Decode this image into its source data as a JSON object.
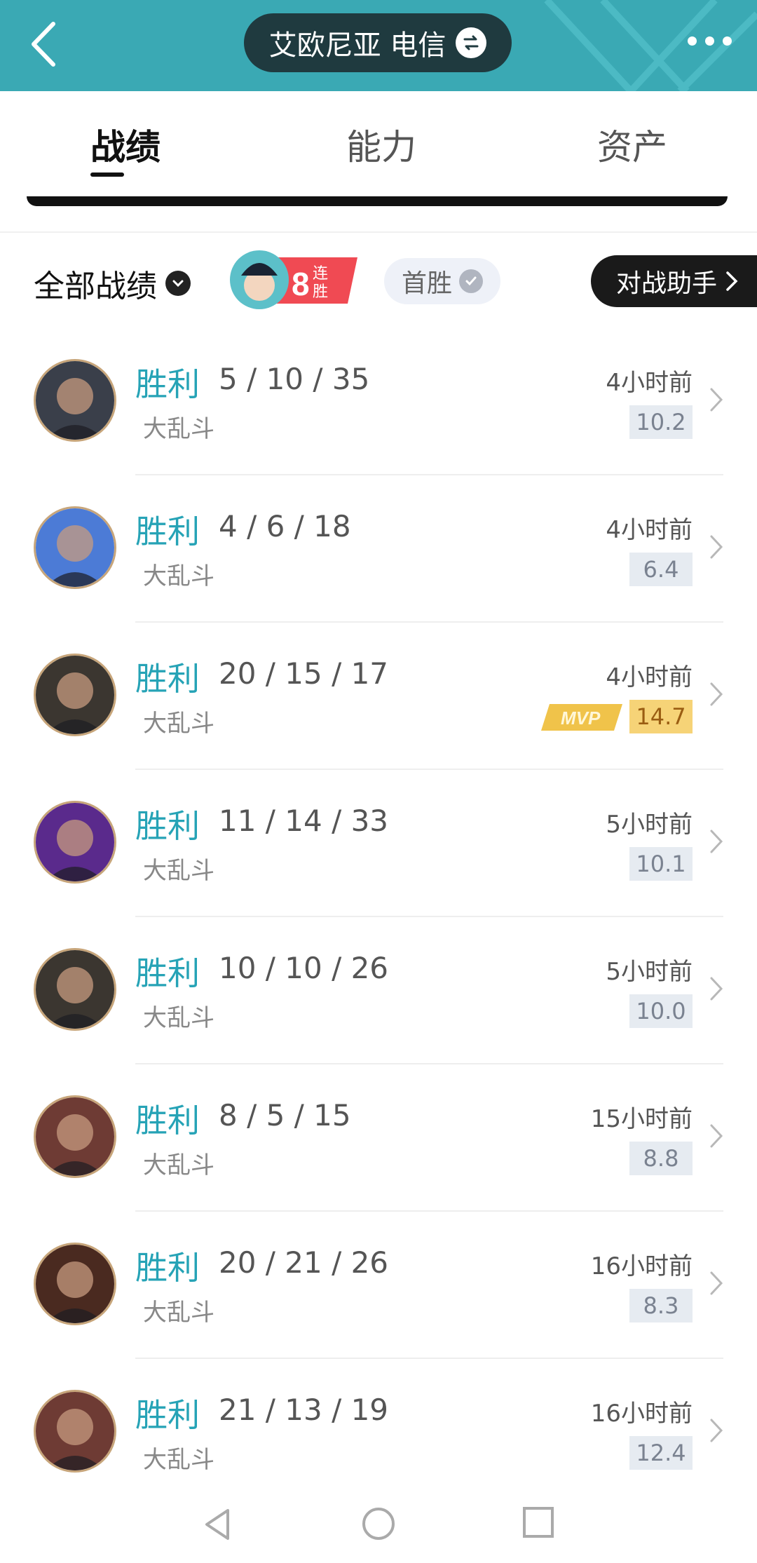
{
  "header": {
    "server_name": "艾欧尼亚 电信",
    "back_icon": "chevron-left-icon",
    "swap_icon": "swap-icon",
    "more_icon": "more-dots-icon"
  },
  "tabs": [
    {
      "label": "战绩",
      "active": true
    },
    {
      "label": "能力",
      "active": false
    },
    {
      "label": "资产",
      "active": false
    }
  ],
  "filter": {
    "label": "全部战绩",
    "streak_count": "8",
    "streak_text": "连胜",
    "first_win": "首胜",
    "assistant": "对战助手"
  },
  "matches": [
    {
      "result": "胜利",
      "kda": "5 / 10 / 35",
      "mode": "大乱斗",
      "time": "4小时前",
      "score": "10.2",
      "mvp": false,
      "avatar_color": "#3a3f4a"
    },
    {
      "result": "胜利",
      "kda": "4 / 6 / 18",
      "mode": "大乱斗",
      "time": "4小时前",
      "score": "6.4",
      "mvp": false,
      "avatar_color": "#4c7bd6"
    },
    {
      "result": "胜利",
      "kda": "20 / 15 / 17",
      "mode": "大乱斗",
      "time": "4小时前",
      "score": "14.7",
      "mvp": true,
      "avatar_color": "#3b3630"
    },
    {
      "result": "胜利",
      "kda": "11 / 14 / 33",
      "mode": "大乱斗",
      "time": "5小时前",
      "score": "10.1",
      "mvp": false,
      "avatar_color": "#5a2a8c"
    },
    {
      "result": "胜利",
      "kda": "10 / 10 / 26",
      "mode": "大乱斗",
      "time": "5小时前",
      "score": "10.0",
      "mvp": false,
      "avatar_color": "#3b3630"
    },
    {
      "result": "胜利",
      "kda": "8 / 5 / 15",
      "mode": "大乱斗",
      "time": "15小时前",
      "score": "8.8",
      "mvp": false,
      "avatar_color": "#6e3b34"
    },
    {
      "result": "胜利",
      "kda": "20 / 21 / 26",
      "mode": "大乱斗",
      "time": "16小时前",
      "score": "8.3",
      "mvp": false,
      "avatar_color": "#4a2a20"
    },
    {
      "result": "胜利",
      "kda": "21 / 13 / 19",
      "mode": "大乱斗",
      "time": "16小时前",
      "score": "12.4",
      "mvp": false,
      "avatar_color": "#6e3b34"
    }
  ],
  "mvp_label": "MVP",
  "colors": {
    "header_bg": "#3aa9b4",
    "win_color": "#26a3b6",
    "mvp_gold": "#f6d377"
  }
}
